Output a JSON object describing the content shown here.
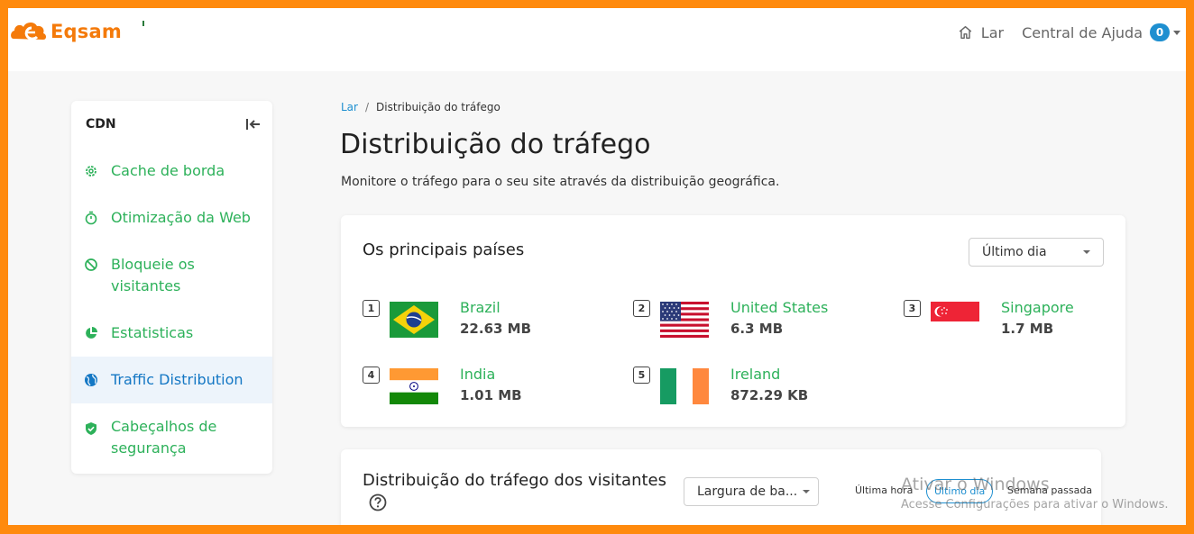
{
  "brand": {
    "name": "Eqsam",
    "color": "#f47a0a"
  },
  "topnav": {
    "home_label": "Lar",
    "help_label": "Central de Ajuda",
    "help_badge": "0"
  },
  "sidebar": {
    "title": "CDN",
    "items": [
      {
        "label": "Cache de borda",
        "icon": "gear-icon"
      },
      {
        "label": "Otimização da Web",
        "icon": "stopwatch-icon"
      },
      {
        "label": "Bloqueie os visitantes",
        "icon": "block-icon"
      },
      {
        "label": "Estatisticas",
        "icon": "pie-chart-icon"
      },
      {
        "label": "Traffic Distribution",
        "icon": "globe-icon",
        "active": true
      },
      {
        "label": "Cabeçalhos de segurança",
        "icon": "shield-check-icon"
      }
    ]
  },
  "breadcrumb": {
    "home": "Lar",
    "separator": "/",
    "current": "Distribuição do tráfego"
  },
  "page": {
    "title": "Distribuição do tráfego",
    "subtitle": "Monitore o tráfego para o seu site através da distribuição geográfica."
  },
  "top_countries": {
    "title": "Os principais países",
    "period_select": "Último dia",
    "countries": [
      {
        "rank": "1",
        "name": "Brazil",
        "value": "22.63 MB"
      },
      {
        "rank": "2",
        "name": "United States",
        "value": "6.3 MB"
      },
      {
        "rank": "3",
        "name": "Singapore",
        "value": "1.7 MB"
      },
      {
        "rank": "4",
        "name": "India",
        "value": "1.01 MB"
      },
      {
        "rank": "5",
        "name": "Ireland",
        "value": "872.29 KB"
      }
    ]
  },
  "visitors": {
    "title": "Distribuição do tráfego dos visitantes",
    "metric_select": "Largura de ba...",
    "periods": [
      "Última hora",
      "Último dia",
      "Semana passada"
    ],
    "active_period": "Último dia"
  },
  "watermark": {
    "line1": "Ativar o Windows",
    "line2": "Acesse Configurações para ativar o Windows."
  },
  "colors": {
    "green": "#2db15a",
    "blue": "#1e8fd0",
    "border": "#ff8a0d"
  }
}
